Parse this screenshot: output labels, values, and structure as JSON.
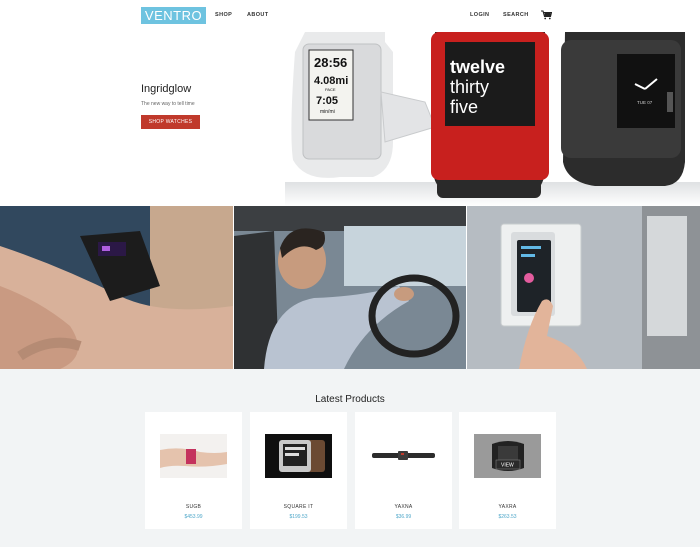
{
  "header": {
    "logo": "VENTRO",
    "nav": [
      "SHOP",
      "ABOUT"
    ],
    "login": "LOGIN",
    "search": "SEARCH",
    "cart_icon": "cart-icon"
  },
  "hero": {
    "title": "Ingridglow",
    "subtitle": "The new way to tell time",
    "button": "SHOP WATCHES",
    "watch_faces": {
      "left": [
        "28:56",
        "4.08mi",
        "PACE",
        "7:05",
        "min/mi"
      ],
      "center": [
        "twelve",
        "thirty",
        "five"
      ],
      "right": [
        "TUE 07"
      ]
    }
  },
  "products": {
    "title": "Latest Products",
    "items": [
      {
        "name": "SUGB",
        "price": "$453.99"
      },
      {
        "name": "SQUARE IT",
        "price": "$199.53"
      },
      {
        "name": "YAXNA",
        "price": "$36.99"
      },
      {
        "name": "YAXRA",
        "price": "$263.53",
        "overlay": "VIEW"
      }
    ]
  },
  "colors": {
    "accent": "#6ec3e0",
    "button": "#c0392b",
    "price": "#4fa7c9",
    "products_bg": "#f2f4f5"
  }
}
